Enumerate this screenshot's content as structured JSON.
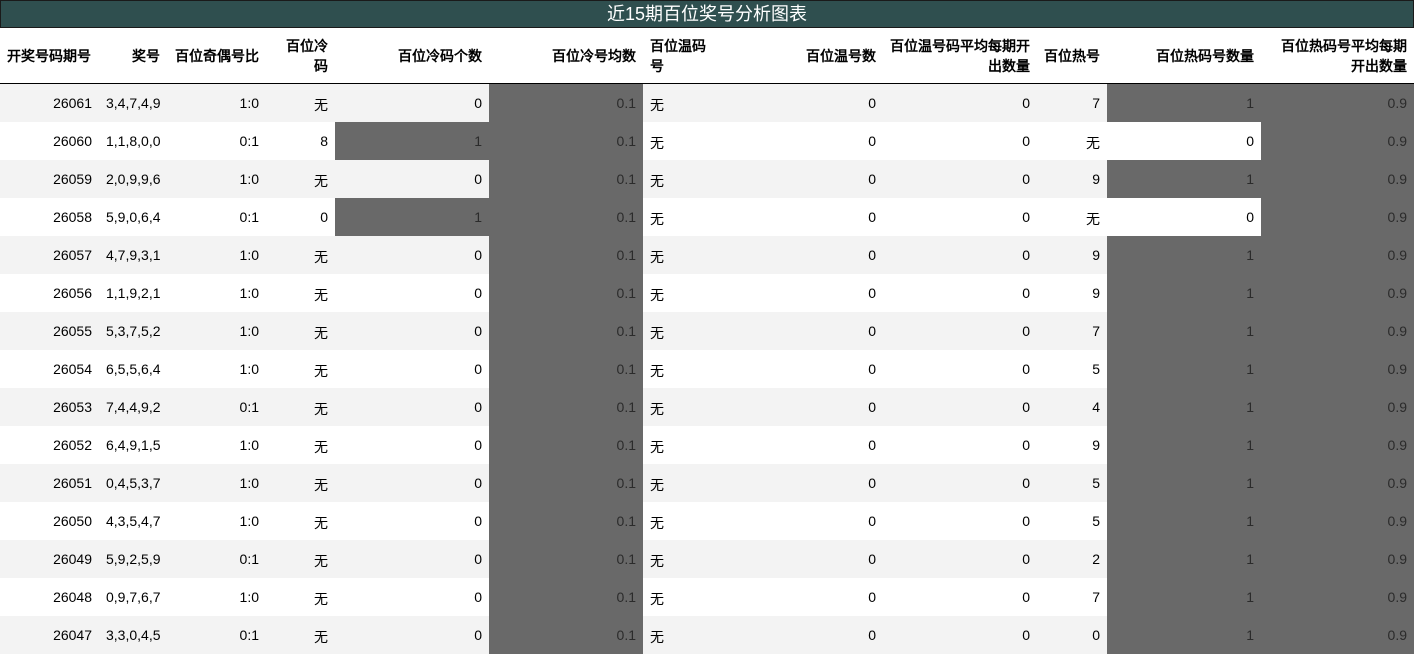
{
  "title": "近15期百位奖号分析图表",
  "colors": {
    "title_bg": "#2f4f4f",
    "highlight": "#696969",
    "stripe": "#f3f3f3"
  },
  "columns": [
    "开奖号码期号",
    "奖号",
    "百位奇偶号比",
    "百位冷码",
    "百位冷码个数",
    "百位冷号均数",
    "百位温码号",
    "百位温号数",
    "百位温号码平均每期开出数量",
    "百位热号",
    "百位热码号数量",
    "百位热码号平均每期开出数量"
  ],
  "rows": [
    [
      "26061",
      "3,4,7,4,9",
      "1:0",
      "无",
      "0",
      "0.1",
      "无",
      "0",
      "0",
      "7",
      "1",
      "0.9"
    ],
    [
      "26060",
      "1,1,8,0,0",
      "0:1",
      "8",
      "1",
      "0.1",
      "无",
      "0",
      "0",
      "无",
      "0",
      "0.9"
    ],
    [
      "26059",
      "2,0,9,9,6",
      "1:0",
      "无",
      "0",
      "0.1",
      "无",
      "0",
      "0",
      "9",
      "1",
      "0.9"
    ],
    [
      "26058",
      "5,9,0,6,4",
      "0:1",
      "0",
      "1",
      "0.1",
      "无",
      "0",
      "0",
      "无",
      "0",
      "0.9"
    ],
    [
      "26057",
      "4,7,9,3,1",
      "1:0",
      "无",
      "0",
      "0.1",
      "无",
      "0",
      "0",
      "9",
      "1",
      "0.9"
    ],
    [
      "26056",
      "1,1,9,2,1",
      "1:0",
      "无",
      "0",
      "0.1",
      "无",
      "0",
      "0",
      "9",
      "1",
      "0.9"
    ],
    [
      "26055",
      "5,3,7,5,2",
      "1:0",
      "无",
      "0",
      "0.1",
      "无",
      "0",
      "0",
      "7",
      "1",
      "0.9"
    ],
    [
      "26054",
      "6,5,5,6,4",
      "1:0",
      "无",
      "0",
      "0.1",
      "无",
      "0",
      "0",
      "5",
      "1",
      "0.9"
    ],
    [
      "26053",
      "7,4,4,9,2",
      "0:1",
      "无",
      "0",
      "0.1",
      "无",
      "0",
      "0",
      "4",
      "1",
      "0.9"
    ],
    [
      "26052",
      "6,4,9,1,5",
      "1:0",
      "无",
      "0",
      "0.1",
      "无",
      "0",
      "0",
      "9",
      "1",
      "0.9"
    ],
    [
      "26051",
      "0,4,5,3,7",
      "1:0",
      "无",
      "0",
      "0.1",
      "无",
      "0",
      "0",
      "5",
      "1",
      "0.9"
    ],
    [
      "26050",
      "4,3,5,4,7",
      "1:0",
      "无",
      "0",
      "0.1",
      "无",
      "0",
      "0",
      "5",
      "1",
      "0.9"
    ],
    [
      "26049",
      "5,9,2,5,9",
      "0:1",
      "无",
      "0",
      "0.1",
      "无",
      "0",
      "0",
      "2",
      "1",
      "0.9"
    ],
    [
      "26048",
      "0,9,7,6,7",
      "1:0",
      "无",
      "0",
      "0.1",
      "无",
      "0",
      "0",
      "7",
      "1",
      "0.9"
    ],
    [
      "26047",
      "3,3,0,4,5",
      "0:1",
      "无",
      "0",
      "0.1",
      "无",
      "0",
      "0",
      "0",
      "1",
      "0.9"
    ]
  ]
}
